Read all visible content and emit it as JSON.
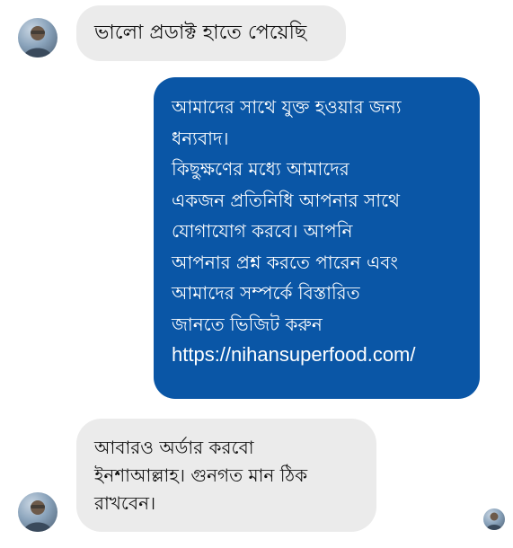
{
  "conversation": {
    "messages": [
      {
        "direction": "incoming",
        "text": "ভালো প্রডাক্ট হাতে পেয়েছি",
        "avatar_icon": "user-avatar-icon"
      },
      {
        "direction": "outgoing",
        "text": "আমাদের সাথে যুক্ত হওয়ার জন্য\nধন্যবাদ।\nকিছুক্ষণের মধ্যে আমাদের\nএকজন প্রতিনিধি আপনার সাথে\nযোগাযোগ করবে। আপনি\nআপনার প্রশ্ন করতে পারেন এবং\nআমাদের সম্পর্কে বিস্তারিত\nজানতে ভিজিট করুন",
        "link": "https://nihansuperfood.com/",
        "bubble_color": "#0a56a6"
      },
      {
        "direction": "incoming",
        "text": "আবারও অর্ডার করবো\nইনশাআল্লাহ। গুনগত মান ঠিক\nরাখবেন।",
        "avatar_icon": "user-avatar-icon"
      }
    ],
    "seen_indicator_icon": "seen-avatar-icon"
  }
}
